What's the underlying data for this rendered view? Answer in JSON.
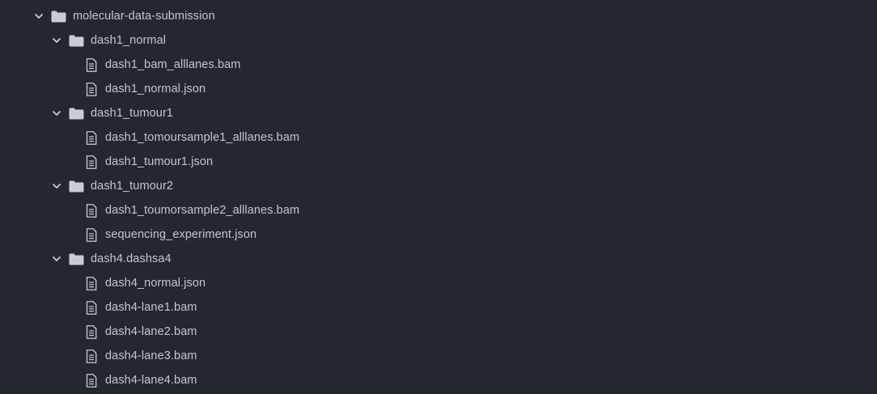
{
  "tree": {
    "root": {
      "label": "molecular-data-submission",
      "icon": "folder-icon",
      "expanded": true
    },
    "folders": [
      {
        "label": "dash1_normal",
        "icon": "folder-icon",
        "expanded": true,
        "files": [
          {
            "label": "dash1_bam_alllanes.bam",
            "icon": "file-icon"
          },
          {
            "label": "dash1_normal.json",
            "icon": "file-icon"
          }
        ]
      },
      {
        "label": "dash1_tumour1",
        "icon": "folder-icon",
        "expanded": true,
        "files": [
          {
            "label": "dash1_tomoursample1_alllanes.bam",
            "icon": "file-icon"
          },
          {
            "label": "dash1_tumour1.json",
            "icon": "file-icon"
          }
        ]
      },
      {
        "label": "dash1_tumour2",
        "icon": "folder-icon",
        "expanded": true,
        "files": [
          {
            "label": "dash1_toumorsample2_alllanes.bam",
            "icon": "file-icon"
          },
          {
            "label": "sequencing_experiment.json",
            "icon": "file-icon"
          }
        ]
      },
      {
        "label": "dash4.dashsa4",
        "icon": "folder-icon",
        "expanded": true,
        "files": [
          {
            "label": "dash4_normal.json",
            "icon": "file-icon"
          },
          {
            "label": "dash4-lane1.bam",
            "icon": "file-icon"
          },
          {
            "label": "dash4-lane2.bam",
            "icon": "file-icon"
          },
          {
            "label": "dash4-lane3.bam",
            "icon": "file-icon"
          },
          {
            "label": "dash4-lane4.bam",
            "icon": "file-icon"
          }
        ]
      }
    ]
  },
  "colors": {
    "background": "#23272e",
    "text": "#c3c8d0",
    "icon": "#c8ccd4"
  }
}
